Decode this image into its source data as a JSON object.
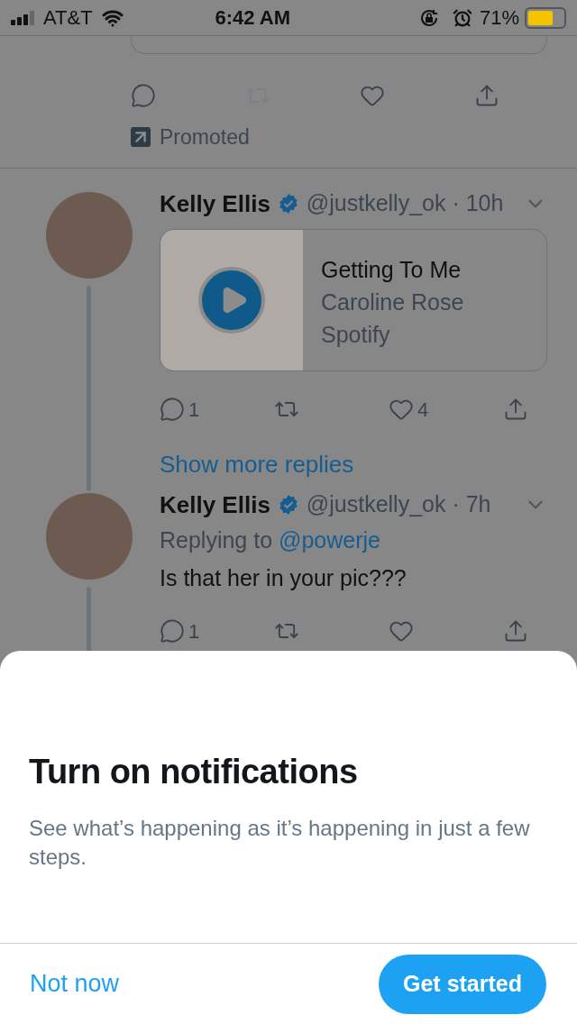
{
  "status_bar": {
    "carrier": "AT&T",
    "time": "6:42 AM",
    "battery": {
      "text": "71%",
      "level": 0.71
    }
  },
  "promoted_tweet": {
    "actions": [
      {
        "kind": "reply",
        "disabled": false
      },
      {
        "kind": "retweet",
        "disabled": true
      },
      {
        "kind": "like",
        "disabled": false
      },
      {
        "kind": "share",
        "disabled": false
      }
    ],
    "label": "Promoted"
  },
  "thread": [
    {
      "name": "Kelly Ellis",
      "verified": true,
      "handle": "@justkelly_ok · 10h",
      "card": {
        "title": "Getting To Me",
        "artist": "Caroline Rose",
        "source": "Spotify"
      },
      "actions": [
        {
          "kind": "reply",
          "count": "1",
          "disabled": false
        },
        {
          "kind": "retweet",
          "disabled": false
        },
        {
          "kind": "like",
          "count": "4",
          "disabled": false
        },
        {
          "kind": "share",
          "disabled": false
        }
      ],
      "show_more": "Show more replies"
    },
    {
      "name": "Kelly Ellis",
      "verified": true,
      "handle": "@justkelly_ok · 7h",
      "replying_to": "Replying to",
      "reply_handle": "@powerje",
      "text": "Is that her in your pic???",
      "actions": [
        {
          "kind": "reply",
          "count": "1",
          "disabled": false
        },
        {
          "kind": "retweet",
          "disabled": false
        },
        {
          "kind": "like",
          "disabled": false
        },
        {
          "kind": "share",
          "disabled": false
        }
      ]
    }
  ],
  "sheet": {
    "title": "Turn on notifications",
    "description": "See what’s happening as it’s happening in just a few steps.",
    "buttons": [
      {
        "label": "Not now",
        "kind": "text"
      },
      {
        "label": "Get started",
        "kind": "primary"
      }
    ]
  }
}
